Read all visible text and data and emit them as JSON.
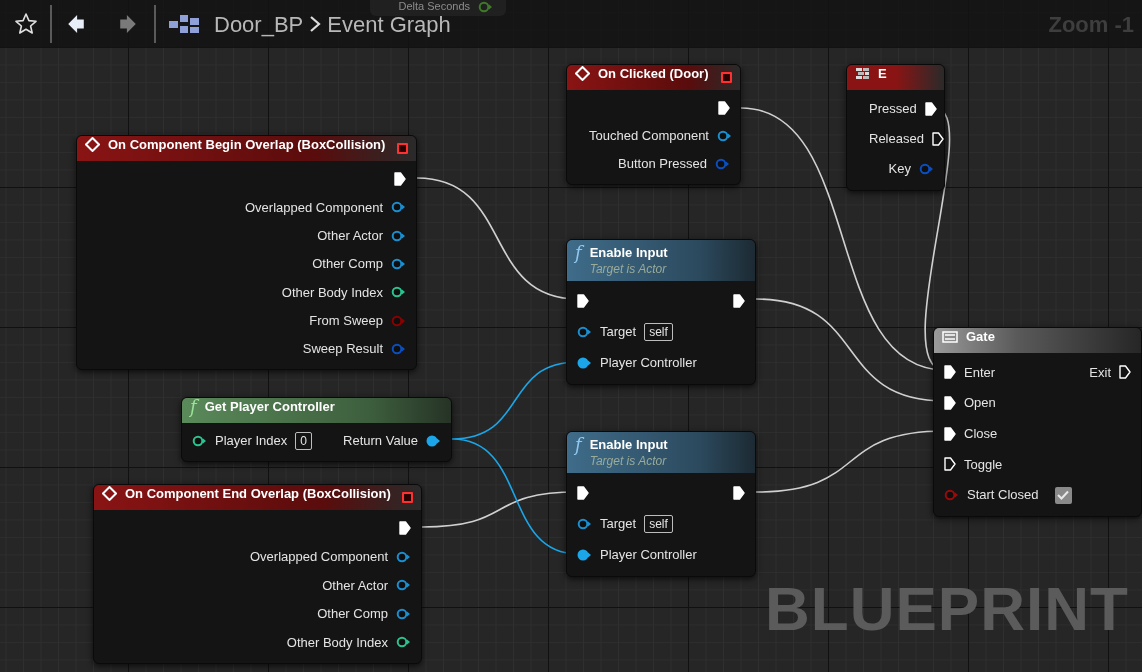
{
  "toolbar": {
    "nav_buttons": [
      {
        "kind": "back",
        "disabled": false
      },
      {
        "kind": "forward",
        "disabled": true
      }
    ],
    "breadcrumb": [
      {
        "label": "Door_BP"
      },
      {
        "label": "Event Graph"
      }
    ]
  },
  "hidden_node_pin": "Delta Seconds",
  "zoom_label": "Zoom -1",
  "graph_label": "BLUEPRINT",
  "nodes": [
    {
      "kind": "event",
      "title": "On Clicked (Door)",
      "rows": [
        {
          "right": {
            "kind": "exec",
            "connected": true
          }
        },
        {
          "right": {
            "kind": "data",
            "label": "Touched Component",
            "connected": false,
            "color": "#1a8fd0"
          }
        },
        {
          "right": {
            "kind": "data",
            "label": "Button Pressed",
            "connected": false,
            "color": "#0a4fc0"
          }
        }
      ]
    },
    {
      "kind": "input",
      "title": "E",
      "rows": [
        {
          "right": {
            "kind": "exec",
            "label": "Pressed",
            "connected": true
          }
        },
        {
          "right": {
            "kind": "exec",
            "label": "Released",
            "connected": false
          }
        },
        {
          "right": {
            "kind": "data",
            "label": "Key",
            "connected": false,
            "color": "#0a4fc0"
          }
        }
      ]
    },
    {
      "kind": "event",
      "title": "On Component Begin Overlap (BoxCollision)",
      "rows": [
        {
          "right": {
            "kind": "exec",
            "connected": true
          }
        },
        {
          "right": {
            "kind": "data",
            "label": "Overlapped Component",
            "connected": false,
            "color": "#1a8fd0"
          }
        },
        {
          "right": {
            "kind": "data",
            "label": "Other Actor",
            "connected": false,
            "color": "#1a8fd0"
          }
        },
        {
          "right": {
            "kind": "data",
            "label": "Other Comp",
            "connected": false,
            "color": "#1a8fd0"
          }
        },
        {
          "right": {
            "kind": "data",
            "label": "Other Body Index",
            "connected": false,
            "color": "#2ac38f"
          }
        },
        {
          "right": {
            "kind": "data",
            "label": "From Sweep",
            "connected": false,
            "color": "#8a0000"
          }
        },
        {
          "right": {
            "kind": "data",
            "label": "Sweep Result",
            "connected": false,
            "color": "#0a4fc0"
          }
        }
      ]
    },
    {
      "kind": "function",
      "glyph": "f",
      "title": "Enable Input",
      "subtitle": "Target is Actor",
      "rows": [
        {
          "left": {
            "kind": "exec",
            "connected": true
          },
          "right": {
            "kind": "exec",
            "connected": true
          }
        },
        {
          "left": {
            "kind": "data",
            "label": "Target",
            "default": "self",
            "connected": false,
            "color": "#1a8fd0"
          }
        },
        {
          "left": {
            "kind": "data",
            "label": "Player Controller",
            "connected": true,
            "color": "#1aa6e8"
          }
        }
      ]
    },
    {
      "kind": "gate",
      "title": "Gate",
      "rows": [
        {
          "left": {
            "kind": "exec",
            "label": "Enter",
            "connected": true
          },
          "right": {
            "kind": "exec",
            "label": "Exit",
            "connected": false
          }
        },
        {
          "left": {
            "kind": "exec",
            "label": "Open",
            "connected": true
          }
        },
        {
          "left": {
            "kind": "exec",
            "label": "Close",
            "connected": true
          }
        },
        {
          "left": {
            "kind": "exec",
            "label": "Toggle",
            "connected": false
          }
        },
        {
          "left": {
            "kind": "data",
            "label": "Start Closed",
            "connected": false,
            "color": "#9a0a0a",
            "checked": true
          }
        }
      ]
    },
    {
      "kind": "pure",
      "glyph": "f",
      "title": "Get Player Controller",
      "rows": [
        {
          "left": {
            "kind": "data",
            "label": "Player Index",
            "default": "0",
            "connected": false,
            "color": "#2ac38f"
          },
          "right": {
            "kind": "data",
            "label": "Return Value",
            "connected": true,
            "color": "#1aa6e8"
          }
        }
      ]
    },
    {
      "kind": "function",
      "glyph": "f",
      "title": "Enable Input",
      "subtitle": "Target is Actor",
      "rows": [
        {
          "left": {
            "kind": "exec",
            "connected": true
          },
          "right": {
            "kind": "exec",
            "connected": true
          }
        },
        {
          "left": {
            "kind": "data",
            "label": "Target",
            "default": "self",
            "connected": false,
            "color": "#1a8fd0"
          }
        },
        {
          "left": {
            "kind": "data",
            "label": "Player Controller",
            "connected": true,
            "color": "#1aa6e8"
          }
        }
      ]
    },
    {
      "kind": "event",
      "title": "On Component End Overlap (BoxCollision)",
      "rows": [
        {
          "right": {
            "kind": "exec",
            "connected": true
          }
        },
        {
          "right": {
            "kind": "data",
            "label": "Overlapped Component",
            "connected": false,
            "color": "#1a8fd0"
          }
        },
        {
          "right": {
            "kind": "data",
            "label": "Other Actor",
            "connected": false,
            "color": "#1a8fd0"
          }
        },
        {
          "right": {
            "kind": "data",
            "label": "Other Comp",
            "connected": false,
            "color": "#1a8fd0"
          }
        },
        {
          "right": {
            "kind": "data",
            "label": "Other Body Index",
            "connected": false,
            "color": "#2ac38f"
          }
        }
      ]
    }
  ]
}
